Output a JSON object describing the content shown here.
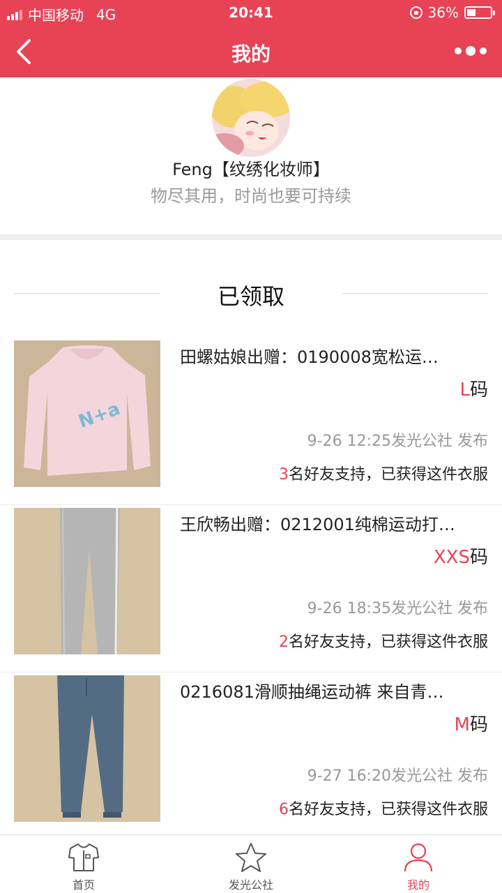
{
  "status_bar": {
    "carrier": "中国移动",
    "network": "4G",
    "time": "20:41",
    "battery": "36%"
  },
  "nav": {
    "title": "我的",
    "back_icon": "chevron-left-icon",
    "more_icon": "more-dots-icon"
  },
  "profile": {
    "name": "Feng【纹绣化妆师】",
    "motto": "物尽其用，时尚也要可持续"
  },
  "section": {
    "title": "已领取"
  },
  "items": [
    {
      "title": "田螺姑娘出赠：0190008宽松运…",
      "size_value": "L",
      "size_unit": "码",
      "time": "9-26 12:25发光公社 发布",
      "support_count": "3",
      "support_text": "名好友支持，已获得这件衣服"
    },
    {
      "title": "王欣畅出赠：0212001纯棉运动打…",
      "size_value": "XXS",
      "size_unit": "码",
      "time": "9-26 18:35发光公社 发布",
      "support_count": "2",
      "support_text": "名好友支持，已获得这件衣服"
    },
    {
      "title": "0216081滑顺抽绳运动裤 来自青…",
      "size_value": "M",
      "size_unit": "码",
      "time": "9-27 16:20发光公社 发布",
      "support_count": "6",
      "support_text": "名好友支持，已获得这件衣服"
    }
  ],
  "tabbar": {
    "tabs": [
      {
        "label": "首页",
        "icon": "shirt-icon"
      },
      {
        "label": "发光公社",
        "icon": "star-icon"
      },
      {
        "label": "我的",
        "icon": "user-icon"
      }
    ],
    "active_color": "#e84255"
  },
  "colors": {
    "brand": "#e84255"
  }
}
